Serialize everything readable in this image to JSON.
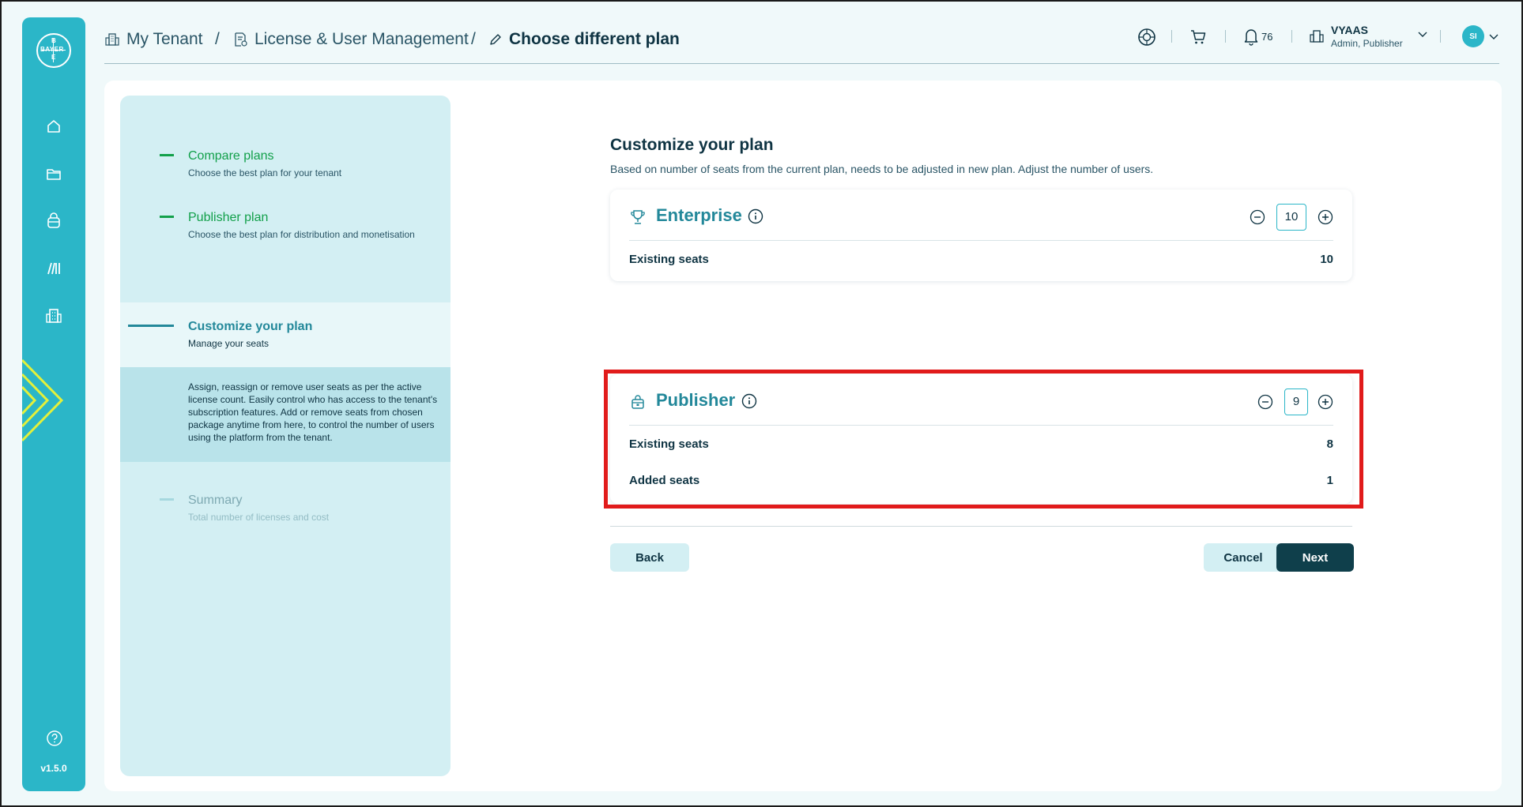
{
  "rail": {
    "logo_text": [
      "BAYER",
      "B",
      "A",
      "E",
      "R"
    ],
    "nav_icons": [
      "home-icon",
      "folder-icon",
      "bag-icon",
      "library-icon",
      "building-icon"
    ],
    "help_icon": "help-icon",
    "version": "v1.5.0"
  },
  "breadcrumb": {
    "items": [
      {
        "label": "My Tenant",
        "icon": "building-icon"
      },
      {
        "label": "License & User Management",
        "icon": "license-icon"
      },
      {
        "label": "Choose different plan",
        "icon": "pencil-icon"
      }
    ],
    "separator": "/"
  },
  "header": {
    "notifications_count": "76",
    "tenant_name": "VYAAS",
    "tenant_roles": "Admin, Publisher",
    "avatar_initials": "SI"
  },
  "stepper": {
    "steps": [
      {
        "title": "Compare plans",
        "subtitle": "Choose the best plan for your tenant",
        "state": "done"
      },
      {
        "title": "Publisher plan",
        "subtitle": "Choose the best plan for distribution and monetisation",
        "state": "done"
      },
      {
        "title": "Customize your plan",
        "subtitle": "Manage your seats",
        "state": "active"
      },
      {
        "title": "Summary",
        "subtitle": "Total number of licenses and cost",
        "state": "pending"
      }
    ],
    "active_description": "Assign, reassign or remove user seats as per the active license count. Easily control who has access to the tenant's subscription features. Add or remove seats from chosen package anytime from here, to control the number of users using the platform from the tenant."
  },
  "content": {
    "title": "Customize your plan",
    "subtitle": "Based on number of seats from the current plan, needs to be adjusted in new plan. Adjust the number of users.",
    "plans": [
      {
        "name": "Enterprise",
        "icon": "trophy-icon",
        "seats": "10",
        "rows": [
          {
            "label": "Existing seats",
            "value": "10"
          }
        ]
      },
      {
        "name": "Publisher",
        "icon": "publisher-icon",
        "seats": "9",
        "rows": [
          {
            "label": "Existing seats",
            "value": "8"
          },
          {
            "label": "Added seats",
            "value": "1"
          }
        ]
      }
    ],
    "buttons": {
      "back": "Back",
      "cancel": "Cancel",
      "next": "Next"
    }
  },
  "colors": {
    "rail": "#2bb6c8",
    "stepper_bg": "#d3eff3",
    "done": "#12a04a",
    "active": "#23889a",
    "highlight": "#e11b1b",
    "primary_button": "#0f3f4b"
  }
}
